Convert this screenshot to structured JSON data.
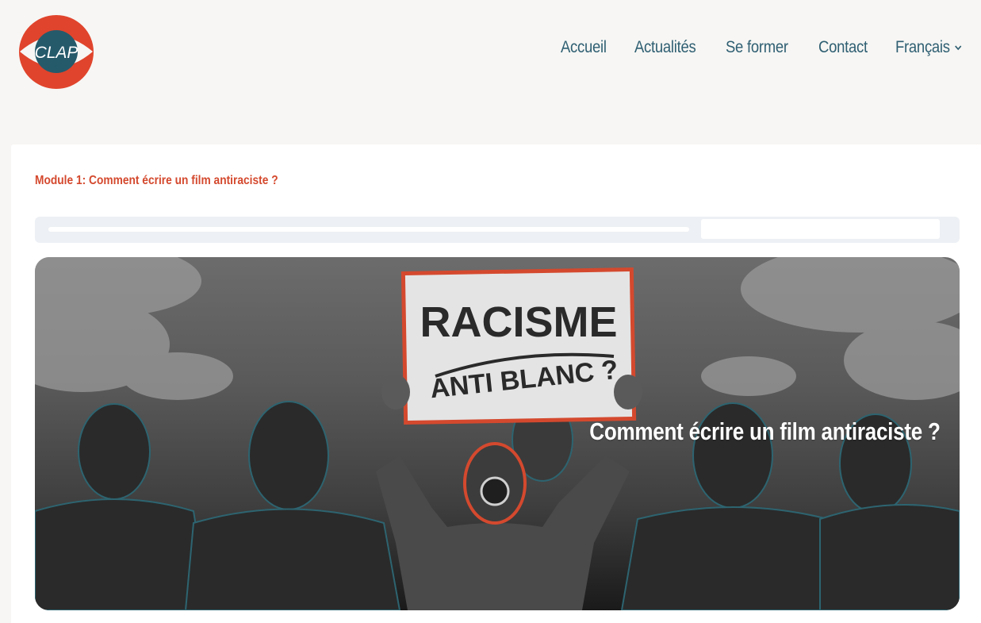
{
  "header": {
    "logo_text": "CLAP",
    "nav": [
      {
        "label": "Accueil"
      },
      {
        "label": "Actualités"
      },
      {
        "label": "Se former"
      },
      {
        "label": "Contact"
      },
      {
        "label": "Français"
      }
    ]
  },
  "module": {
    "title": "Module 1: Comment écrire un film antiraciste ?"
  },
  "progress": {
    "value": 0
  },
  "hero": {
    "sign_line1": "RACISME",
    "sign_line2": "ANTI BLANC ?",
    "caption": "Comment écrire un film antiraciste ?"
  },
  "colors": {
    "accent": "#d4492e",
    "nav": "#2f5f72",
    "logo_red": "#e0442c",
    "logo_teal": "#255a6b"
  }
}
